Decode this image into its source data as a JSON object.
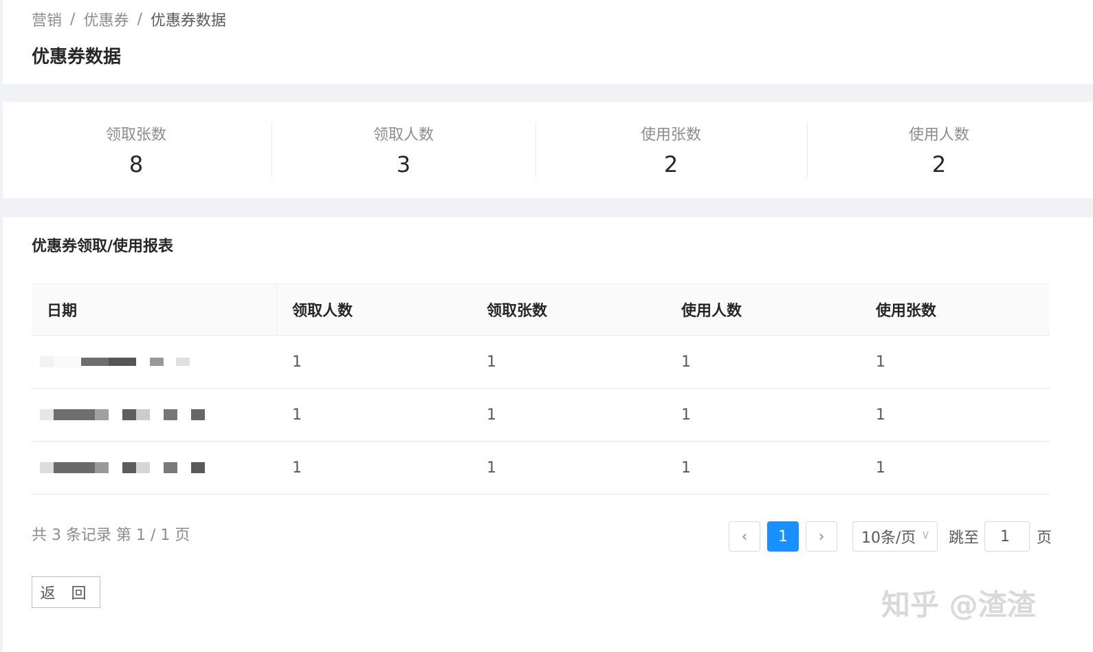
{
  "breadcrumb": {
    "items": [
      "营销",
      "优惠券",
      "优惠券数据"
    ],
    "separator": "/"
  },
  "page_title": "优惠券数据",
  "stats": [
    {
      "label": "领取张数",
      "value": "8"
    },
    {
      "label": "领取人数",
      "value": "3"
    },
    {
      "label": "使用张数",
      "value": "2"
    },
    {
      "label": "使用人数",
      "value": "2"
    }
  ],
  "report": {
    "title": "优惠券领取/使用报表",
    "columns": [
      "日期",
      "领取人数",
      "领取张数",
      "使用人数",
      "使用张数"
    ],
    "rows": [
      {
        "date": "",
        "c1": "1",
        "c2": "1",
        "c3": "1",
        "c4": "1"
      },
      {
        "date": "",
        "c1": "1",
        "c2": "1",
        "c3": "1",
        "c4": "1"
      },
      {
        "date": "",
        "c1": "1",
        "c2": "1",
        "c3": "1",
        "c4": "1"
      }
    ],
    "summary": "共 3 条记录 第 1 / 1 页"
  },
  "pagination": {
    "current_page": "1",
    "page_size_label": "10条/页",
    "jump_label": "跳至",
    "jump_value": "1",
    "page_suffix": "页"
  },
  "back_button": "返 回",
  "watermark": "知乎 @渣渣",
  "colors": {
    "primary": "#1890ff",
    "background": "#f0f2f5"
  }
}
